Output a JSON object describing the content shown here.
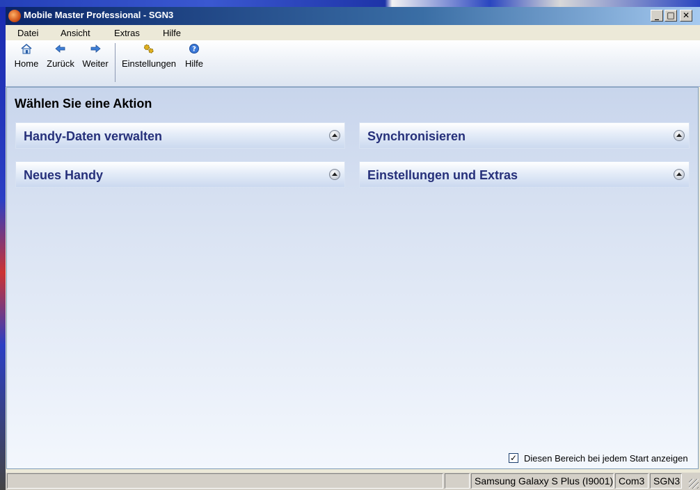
{
  "window": {
    "title": "Mobile Master Professional - SGN3",
    "controls": {
      "minimize": "_",
      "maximize": "□",
      "close": "✕"
    }
  },
  "menubar": {
    "items": [
      "Datei",
      "Ansicht",
      "Extras",
      "Hilfe"
    ]
  },
  "toolbar": {
    "buttons": [
      {
        "label": "Home",
        "icon": "home-icon"
      },
      {
        "label": "Zurück",
        "icon": "arrow-left-icon"
      },
      {
        "label": "Weiter",
        "icon": "arrow-right-icon"
      },
      {
        "label": "Einstellungen",
        "icon": "gears-icon"
      },
      {
        "label": "Hilfe",
        "icon": "help-icon"
      }
    ]
  },
  "main": {
    "heading": "Wählen Sie eine Aktion",
    "panels": [
      {
        "title": "Handy-Daten verwalten",
        "state": "collapsed"
      },
      {
        "title": "Synchronisieren",
        "state": "collapsed"
      },
      {
        "title": "Neues Handy",
        "state": "collapsed"
      },
      {
        "title": "Einstellungen und Extras",
        "state": "collapsed"
      }
    ],
    "show_on_start": {
      "label": "Diesen Bereich bei jedem Start anzeigen",
      "checked": true,
      "mark": "✓"
    }
  },
  "statusbar": {
    "panes": [
      "",
      "",
      "Samsung Galaxy S Plus (I9001)",
      "Com3",
      "SGN3"
    ]
  },
  "colors": {
    "title_bar": "#0a246a",
    "panel_title": "#26307a",
    "content_bg": "#dbe4f3"
  }
}
